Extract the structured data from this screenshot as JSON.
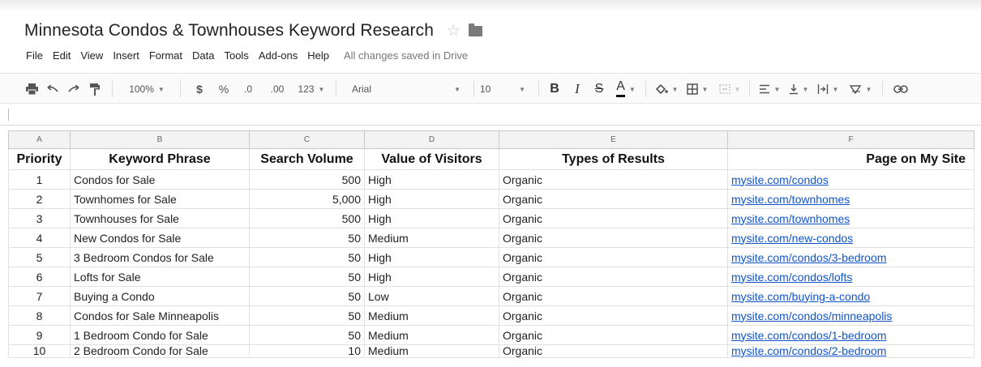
{
  "doc": {
    "title": "Minnesota Condos & Townhouses Keyword Research",
    "save_status": "All changes saved in Drive"
  },
  "menu": [
    "File",
    "Edit",
    "View",
    "Insert",
    "Format",
    "Data",
    "Tools",
    "Add-ons",
    "Help"
  ],
  "toolbar": {
    "zoom": "100%",
    "currency": "$",
    "percent": "%",
    "decrease_decimal": ".0",
    "increase_decimal": ".00",
    "more_formats": "123",
    "font": "Arial",
    "font_size": "10",
    "bold": "B",
    "italic": "I",
    "strike": "S",
    "text_color": "A"
  },
  "columns": [
    "A",
    "B",
    "C",
    "D",
    "E",
    "F"
  ],
  "headers": [
    "Priority",
    "Keyword Phrase",
    "Search Volume",
    "Value of Visitors",
    "Types of Results",
    "Page on My Site"
  ],
  "rows": [
    {
      "priority": "1",
      "keyword": "Condos for Sale",
      "volume": "500",
      "value": "High",
      "type": "Organic",
      "page": "mysite.com/condos"
    },
    {
      "priority": "2",
      "keyword": "Townhomes for Sale",
      "volume": "5,000",
      "value": "High",
      "type": "Organic",
      "page": "mysite.com/townhomes"
    },
    {
      "priority": "3",
      "keyword": "Townhouses for Sale",
      "volume": "500",
      "value": "High",
      "type": "Organic",
      "page": "mysite.com/townhomes"
    },
    {
      "priority": "4",
      "keyword": "New Condos for Sale",
      "volume": "50",
      "value": "Medium",
      "type": "Organic",
      "page": "mysite.com/new-condos"
    },
    {
      "priority": "5",
      "keyword": "3 Bedroom Condos for Sale",
      "volume": "50",
      "value": "High",
      "type": "Organic",
      "page": "mysite.com/condos/3-bedroom"
    },
    {
      "priority": "6",
      "keyword": "Lofts for Sale",
      "volume": "50",
      "value": "High",
      "type": "Organic",
      "page": "mysite.com/condos/lofts"
    },
    {
      "priority": "7",
      "keyword": "Buying a Condo",
      "volume": "50",
      "value": "Low",
      "type": "Organic",
      "page": "mysite.com/buying-a-condo"
    },
    {
      "priority": "8",
      "keyword": "Condos for Sale Minneapolis",
      "volume": "50",
      "value": "Medium",
      "type": "Organic",
      "page": "mysite.com/condos/minneapolis"
    },
    {
      "priority": "9",
      "keyword": "1 Bedroom Condo for Sale",
      "volume": "50",
      "value": "Medium",
      "type": "Organic",
      "page": "mysite.com/condos/1-bedroom"
    },
    {
      "priority": "10",
      "keyword": "2 Bedroom Condo for Sale",
      "volume": "10",
      "value": "Medium",
      "type": "Organic",
      "page": "mysite.com/condos/2-bedroom"
    }
  ],
  "colors": {
    "link": "#1155cc",
    "header_bg": "#f3f3f3"
  }
}
